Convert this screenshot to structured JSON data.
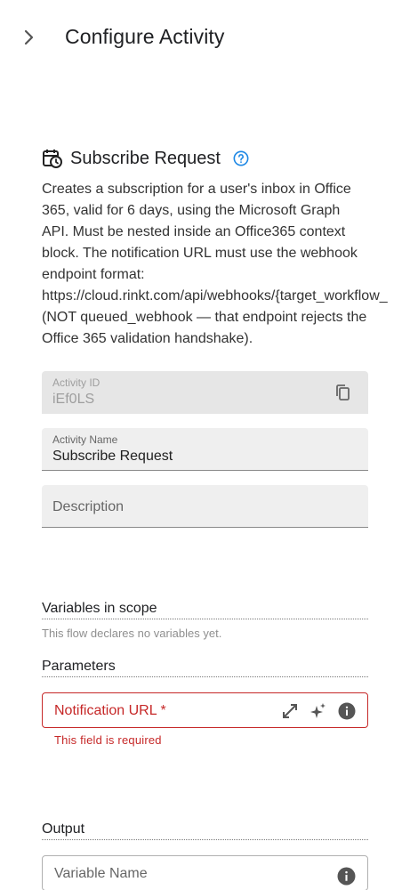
{
  "header": {
    "title": "Configure Activity",
    "collapse_icon": "chevron-right-icon"
  },
  "activity": {
    "icon": "calendar-clock-icon",
    "title": "Subscribe Request",
    "help_icon": "help-circle-icon",
    "description": "Creates a subscription for a user's inbox in Office\n365, valid for 6 days, using the Microsoft Graph\nAPI. Must be nested inside an Office365 context\nblock. The notification URL must use the webhook\nendpoint format:\nhttps://cloud.rinkt.com/api/webhooks/{target_workflow_\n(NOT queued_webhook — that endpoint rejects the\nOffice 365 validation handshake)."
  },
  "fields": {
    "activity_id": {
      "label": "Activity ID",
      "value": "iEf0LS",
      "icon": "copy-icon"
    },
    "activity_name": {
      "label": "Activity Name",
      "value": "Subscribe Request"
    },
    "description": {
      "placeholder": "Description"
    }
  },
  "variables": {
    "title": "Variables in scope",
    "empty_text": "This flow declares no variables yet."
  },
  "parameters": {
    "title": "Parameters",
    "notification_url": {
      "placeholder": "Notification URL *",
      "error": "This field is required",
      "icons": [
        "expand-icon",
        "sparkle-icon",
        "info-icon"
      ]
    }
  },
  "output": {
    "title": "Output",
    "placeholder": "Variable Name",
    "icon": "info-icon"
  },
  "colors": {
    "error": "#c62828",
    "accent": "#1e88e5",
    "field_bg": "#efefef"
  }
}
